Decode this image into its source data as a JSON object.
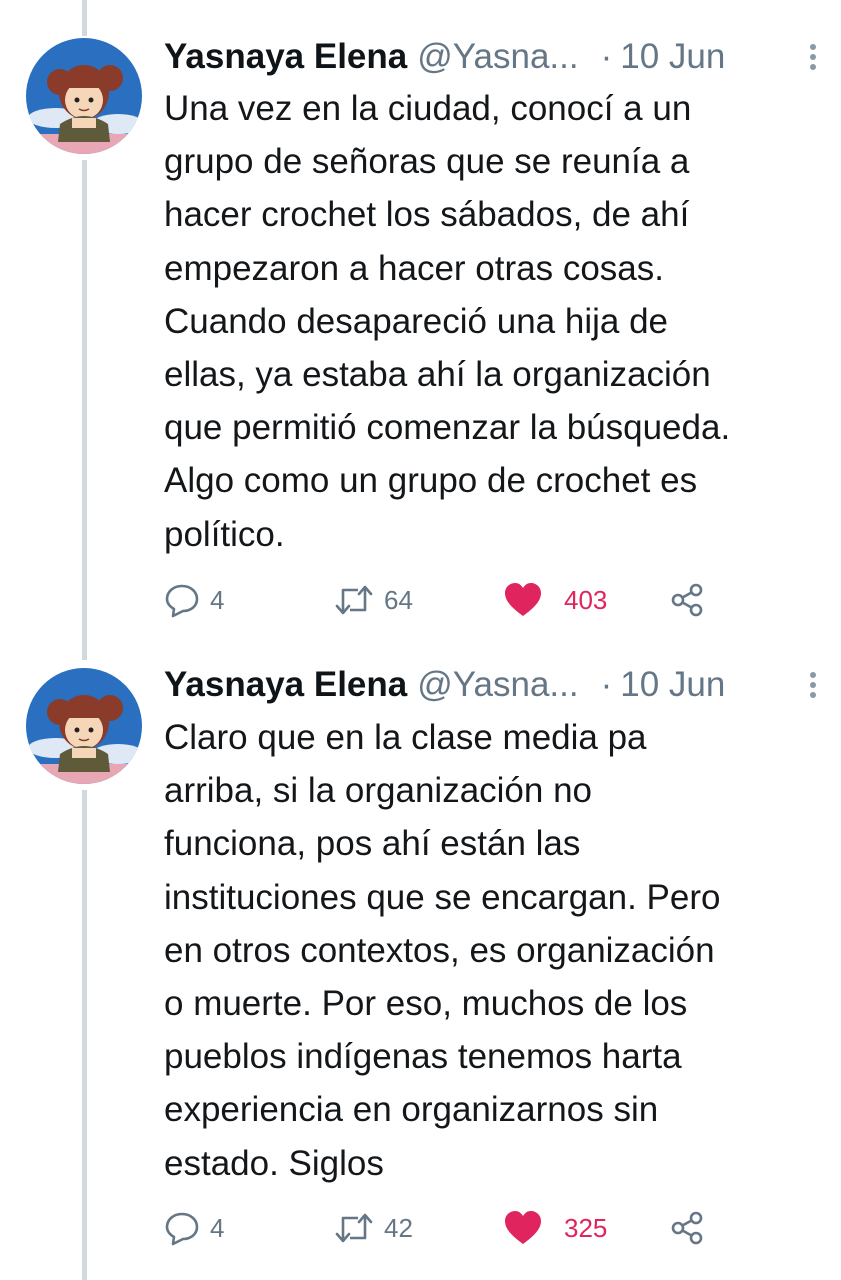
{
  "colors": {
    "text": "#14171a",
    "secondary": "#657786",
    "like": "#e0245e",
    "thread_line": "#cfd9de"
  },
  "tweets": [
    {
      "author_name": "Yasnaya Elena",
      "handle": "@Yasna...",
      "separator": "·",
      "date": "10 Jun",
      "text": "Una vez en la ciudad, conocí a un\ngrupo de señoras que se reunía a\nhacer crochet los sábados, de ahí\nempezaron a hacer otras cosas.\nCuando desapareció una hija de\nellas, ya estaba ahí la organización\nque permitió comenzar la búsqueda.\nAlgo como un grupo de crochet es\npolítico.",
      "replies": "4",
      "retweets": "64",
      "likes": "403",
      "liked": true
    },
    {
      "author_name": "Yasnaya Elena",
      "handle": "@Yasna...",
      "separator": "·",
      "date": "10 Jun",
      "text": "Claro que en la clase media pa\narriba, si la organización no\nfunciona, pos ahí están las\ninstituciones que se encargan. Pero\nen otros contextos, es organización\no muerte. Por eso, muchos de los\npueblos indígenas tenemos harta\nexperiencia en organizarnos sin\nestado. Siglos",
      "replies": "4",
      "retweets": "42",
      "likes": "325",
      "liked": true
    }
  ],
  "icons": {
    "avatar": "anime-girl-avatar",
    "more": "more-vertical-icon",
    "reply": "reply-bubble-icon",
    "retweet": "retweet-icon",
    "like": "heart-filled-icon",
    "share": "share-icon"
  }
}
